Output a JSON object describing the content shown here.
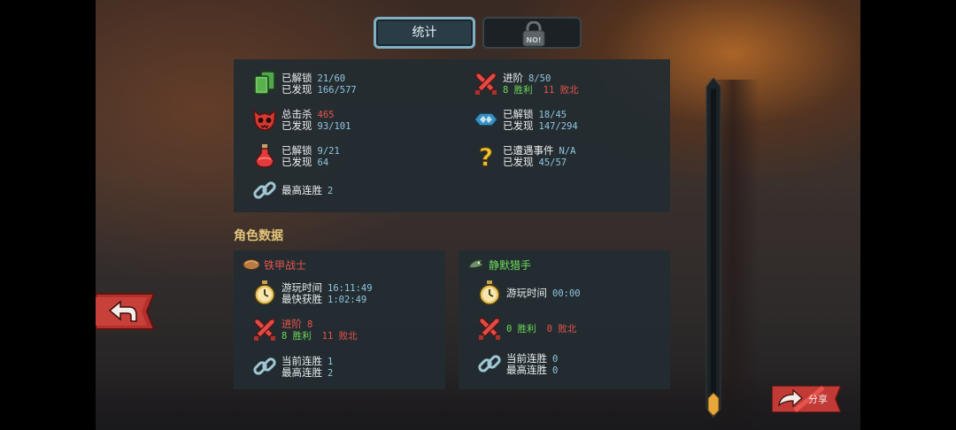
{
  "header": {
    "tabs": [
      {
        "label": "统计",
        "active": true
      },
      {
        "label": "NO!",
        "locked": true
      }
    ]
  },
  "stats": {
    "cards": {
      "l1": "已解锁",
      "v1": "21/60",
      "l2": "已发现",
      "v2": "166/577",
      "icon": "cards-icon"
    },
    "kills": {
      "l1": "总击杀",
      "v1": "465",
      "l2": "已发现",
      "v2": "93/101",
      "icon": "demon-skull-icon"
    },
    "potions": {
      "l1": "已解锁",
      "v1": "9/21",
      "l2": "已发现",
      "v2": "64",
      "icon": "potion-icon"
    },
    "streak": {
      "l1": "最高连胜",
      "v1": "2",
      "icon": "chain-link-icon"
    },
    "ascension": {
      "l1": "进阶",
      "v1": "8/50",
      "wins": "8 胜利",
      "losses": "11 败北",
      "icon": "crossed-swords-icon"
    },
    "relics": {
      "l1": "已解锁",
      "v1": "18/45",
      "l2": "已发现",
      "v2": "147/294",
      "icon": "relic-icon"
    },
    "events": {
      "l1": "已遭遇事件",
      "v1": "N/A",
      "l2": "已发现",
      "v2": "45/57",
      "icon": "question-mark-icon"
    }
  },
  "character_section": {
    "title": "角色数据"
  },
  "characters": [
    {
      "name": "铁甲战士",
      "name_color": "#e8534c",
      "icon": "ironclad-icon",
      "playtime_label": "游玩时间",
      "playtime": "16:11:49",
      "fastest_label": "最快获胜",
      "fastest": "1:02:49",
      "ascension_label": "进阶",
      "ascension": "8",
      "wins": "8 胜利",
      "losses": "11 败北",
      "streak_label": "当前连胜",
      "streak": "1",
      "best_label": "最高连胜",
      "best": "2"
    },
    {
      "name": "静默猎手",
      "name_color": "#6fdc5a",
      "icon": "silent-icon",
      "playtime_label": "游玩时间",
      "playtime": "00:00",
      "wins": "0 胜利",
      "losses": "0 败北",
      "streak_label": "当前连胜",
      "streak": "0",
      "best_label": "最高连胜",
      "best": "0"
    }
  ],
  "footer": {
    "share_label": "分享"
  },
  "colors": {
    "accent_gold": "#e4c57a",
    "value_blue": "#8fc6e0",
    "win_green": "#6fdc5a",
    "loss_red": "#e8534c",
    "panel": "#222c32"
  }
}
